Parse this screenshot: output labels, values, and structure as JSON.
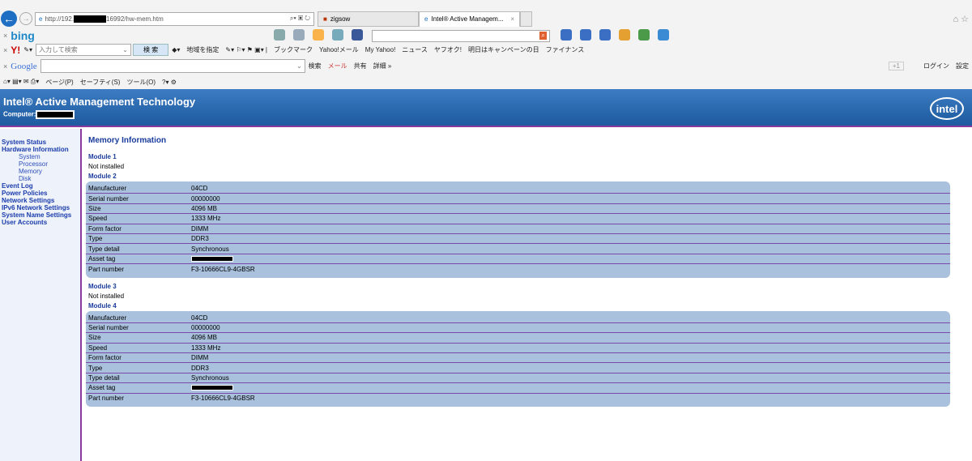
{
  "browser": {
    "url_prefix": "http://192.",
    "url_suffix": "16992/hw-mem.htm",
    "tabs": [
      {
        "label": "zigsow"
      },
      {
        "label": "Intel® Active Managem..."
      }
    ],
    "bing": {
      "logo": "bing"
    },
    "yahoo": {
      "logo": "Y!",
      "search_placeholder": "入力して検索",
      "search_button": "検 索",
      "items": [
        "地域を指定",
        "ブックマーク",
        "Yahoo!メール",
        "My Yahoo!",
        "ニュース",
        "ヤフオク!",
        "明日はキャンペーンの日",
        "ファイナンス"
      ]
    },
    "google": {
      "logo": "Google",
      "search": "検索",
      "mail": "メール",
      "share": "共有",
      "details": "詳細 »",
      "plus": "+1",
      "login": "ログイン",
      "settings": "設定"
    },
    "command": {
      "page": "ページ(P)",
      "safety": "セーフティ(S)",
      "tools": "ツール(O)"
    }
  },
  "header": {
    "title": "Intel® Active Management Technology",
    "computer_label": "Computer:",
    "logo": "intel"
  },
  "sidebar": {
    "items": [
      {
        "label": "System Status",
        "sub": false
      },
      {
        "label": "Hardware Information",
        "sub": false
      },
      {
        "label": "System",
        "sub": true
      },
      {
        "label": "Processor",
        "sub": true
      },
      {
        "label": "Memory",
        "sub": true
      },
      {
        "label": "Disk",
        "sub": true
      },
      {
        "label": "Event Log",
        "sub": false
      },
      {
        "label": "Power Policies",
        "sub": false
      },
      {
        "label": "Network Settings",
        "sub": false
      },
      {
        "label": "IPv6 Network Settings",
        "sub": false
      },
      {
        "label": "System Name Settings",
        "sub": false
      },
      {
        "label": "User Accounts",
        "sub": false
      }
    ]
  },
  "main": {
    "title": "Memory Information",
    "modules": [
      {
        "name": "Module 1",
        "status": "Not installed"
      },
      {
        "name": "Module 2",
        "rows": [
          [
            "Manufacturer",
            "04CD"
          ],
          [
            "Serial number",
            "00000000"
          ],
          [
            "Size",
            "4096 MB"
          ],
          [
            "Speed",
            "1333 MHz"
          ],
          [
            "Form factor",
            "DIMM"
          ],
          [
            "Type",
            "DDR3"
          ],
          [
            "Type detail",
            "Synchronous"
          ],
          [
            "Asset tag",
            ""
          ],
          [
            "Part number",
            "F3-10666CL9-4GBSR"
          ]
        ]
      },
      {
        "name": "Module 3",
        "status": "Not installed"
      },
      {
        "name": "Module 4",
        "rows": [
          [
            "Manufacturer",
            "04CD"
          ],
          [
            "Serial number",
            "00000000"
          ],
          [
            "Size",
            "4096 MB"
          ],
          [
            "Speed",
            "1333 MHz"
          ],
          [
            "Form factor",
            "DIMM"
          ],
          [
            "Type",
            "DDR3"
          ],
          [
            "Type detail",
            "Synchronous"
          ],
          [
            "Asset tag",
            ""
          ],
          [
            "Part number",
            "F3-10666CL9-4GBSR"
          ]
        ]
      }
    ]
  }
}
